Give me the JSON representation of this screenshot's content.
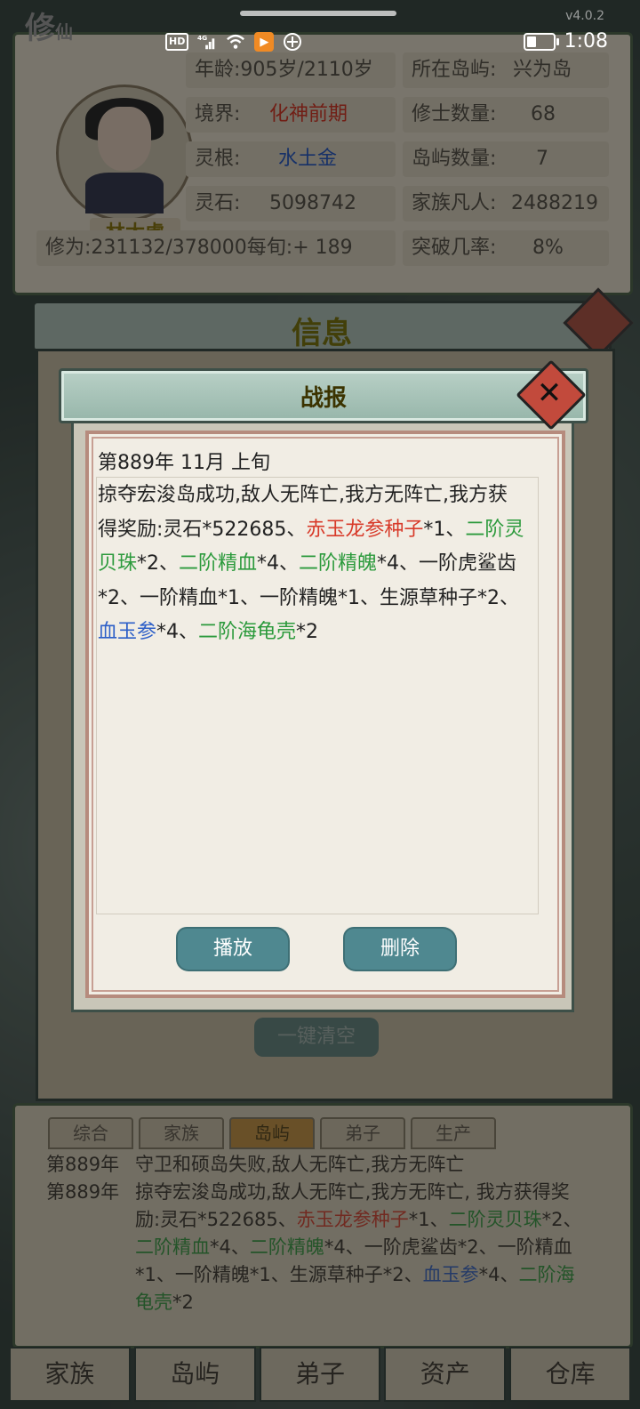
{
  "status": {
    "time": "1:08",
    "hd": "HD",
    "net": "4G",
    "version": "v4.0.2"
  },
  "game_logo": {
    "main": "修",
    "sub": "仙"
  },
  "character": {
    "name": "林太虚",
    "age_label": "年龄:905岁/2110岁",
    "realm_label": "境界:",
    "realm_value": "化神前期",
    "root_label": "灵根:",
    "root_value": "水土金",
    "stones_label": "灵石:",
    "stones_value": "5098742",
    "cultivation": "修为:231132/378000每旬:+ 189",
    "island_label": "所在岛屿:",
    "island_value": "兴为岛",
    "cultivators_label": "修士数量:",
    "cultivators_value": "68",
    "islands_label": "岛屿数量:",
    "islands_value": "7",
    "mortals_label": "家族凡人:",
    "mortals_value": "2488219",
    "breakthrough_label": "突破几率:",
    "breakthrough_value": "8%"
  },
  "info_panel": {
    "title": "信息",
    "clear_all": "一键清空"
  },
  "modal": {
    "title": "战报",
    "date": "第889年 11月 上旬",
    "body_intro": "掠夺宏浚岛成功,敌人无阵亡,我方无阵亡,我方获得奖励:灵石*522685、",
    "item1": "赤玉龙参种子",
    "after1": "*1、",
    "item2": "二阶灵贝珠",
    "after2": "*2、",
    "item3": "二阶精血",
    "after3": "*4、",
    "item4": "二阶精魄",
    "after4": "*4、一阶虎鲨齿*2、一阶精血*1、一阶精魄*1、生源草种子*2、",
    "item5": "血玉参",
    "after5": "*4、",
    "item6": "二阶海龟壳",
    "after6": "*2",
    "play_label": "播放",
    "delete_label": "删除"
  },
  "log_tabs": [
    "综合",
    "家族",
    "岛屿",
    "弟子",
    "生产"
  ],
  "log": [
    {
      "year": "第889年",
      "text": "守卫和硕岛失败,敌人无阵亡,我方无阵亡"
    },
    {
      "year": "第889年",
      "intro": "掠夺宏浚岛成功,敌人无阵亡,我方无阵亡, 我方获得奖励:灵石*522685、",
      "i1": "赤玉龙参种子",
      "a1": "*1、",
      "i2": "二阶灵贝珠",
      "a2": "*2、",
      "i3": "二阶精血",
      "a3": "*4、",
      "i4": "二阶精魄",
      "a4": "*4、一阶虎鲨齿*2、一阶精血*1、一阶精魄*1、生源草种子*2、",
      "i5": "血玉参",
      "a5": "*4、",
      "i6": "二阶海龟壳",
      "a6": "*2"
    }
  ],
  "nav": [
    "家族",
    "岛屿",
    "弟子",
    "资产",
    "仓库"
  ],
  "colors": {
    "red": "#d83b2a",
    "green": "#2c9a3c",
    "blue": "#2d5fc8",
    "button": "#4f8890"
  }
}
